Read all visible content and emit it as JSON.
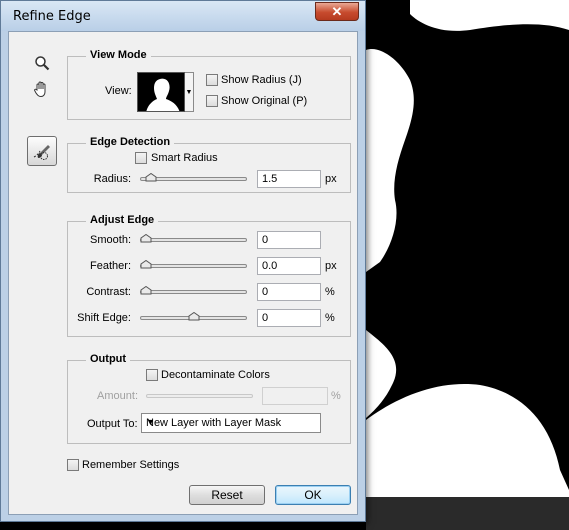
{
  "window": {
    "title": "Refine Edge",
    "close_glyph": "✕"
  },
  "tools": [
    {
      "name": "zoom-icon"
    },
    {
      "name": "hand-icon"
    },
    {
      "name": "refine-radius-brush-icon"
    }
  ],
  "view_mode": {
    "legend": "View Mode",
    "view_label": "View:",
    "show_radius": {
      "label": "Show Radius (J)",
      "checked": false
    },
    "show_original": {
      "label": "Show Original (P)",
      "checked": false
    }
  },
  "edge_detection": {
    "legend": "Edge Detection",
    "smart_radius": {
      "label": "Smart Radius",
      "checked": false
    },
    "radius": {
      "label": "Radius:",
      "value": "1.5",
      "unit": "px",
      "slider_fraction": 0.05
    }
  },
  "adjust_edge": {
    "legend": "Adjust Edge",
    "smooth": {
      "label": "Smooth:",
      "value": "0",
      "unit": "",
      "slider_fraction": 0.0
    },
    "feather": {
      "label": "Feather:",
      "value": "0.0",
      "unit": "px",
      "slider_fraction": 0.0
    },
    "contrast": {
      "label": "Contrast:",
      "value": "0",
      "unit": "%",
      "slider_fraction": 0.0
    },
    "shift_edge": {
      "label": "Shift Edge:",
      "value": "0",
      "unit": "%",
      "slider_fraction": 0.5
    }
  },
  "output": {
    "legend": "Output",
    "decontaminate": {
      "label": "Decontaminate Colors",
      "checked": false
    },
    "amount": {
      "label": "Amount:",
      "value": "",
      "unit": "%"
    },
    "output_to": {
      "label": "Output To:",
      "value": "New Layer with Layer Mask",
      "arrow": "▼"
    }
  },
  "remember": {
    "label": "Remember Settings",
    "checked": false
  },
  "buttons": {
    "reset": "Reset",
    "ok": "OK"
  },
  "colors": {
    "dialog_bg": "#f0f0f0",
    "frame": "#bcd0e6",
    "close": "#c74b2e",
    "canvas_bg": "#000000",
    "canvas_fg": "#ffffff"
  }
}
